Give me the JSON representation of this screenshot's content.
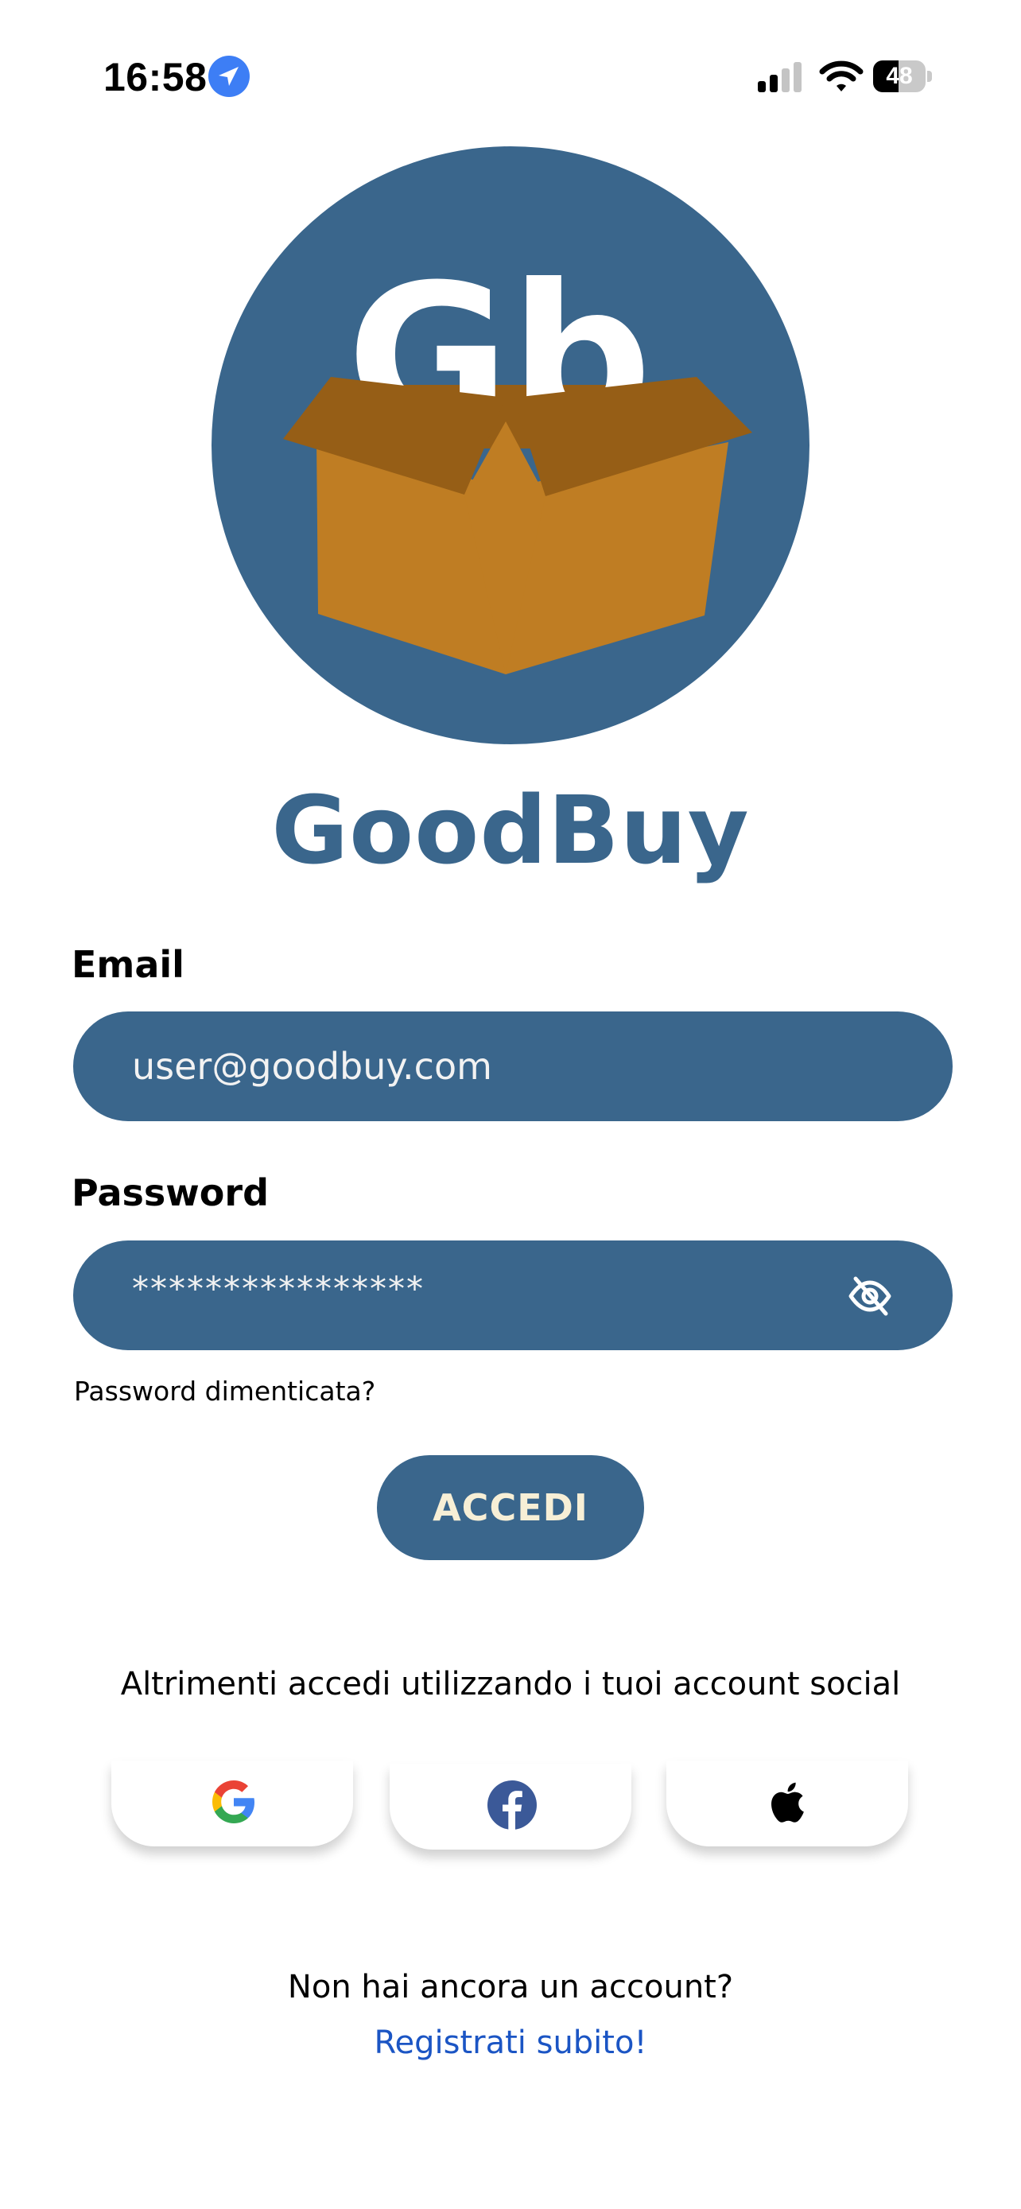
{
  "status_bar": {
    "time": "16:58",
    "battery_percent": "48",
    "battery_level": 0.48,
    "icons": [
      "location-arrow-icon",
      "cellular-signal-icon",
      "wifi-icon",
      "battery-icon"
    ]
  },
  "logo": {
    "monogram": "Gb",
    "colors": {
      "circle": "#3a668c",
      "box_front": "#bf7d23",
      "box_flaps": "#965e16",
      "letters": "#ffffff"
    }
  },
  "app_name": "GoodBuy",
  "form": {
    "email": {
      "label": "Email",
      "value": "user@goodbuy.com"
    },
    "password": {
      "label": "Password",
      "value": "****************",
      "toggle_icon": "eye-off-icon"
    },
    "forgot_password": "Password dimenticata?",
    "submit_label": "ACCEDI"
  },
  "social": {
    "caption": "Altrimenti accedi utilizzando i tuoi account social",
    "providers": [
      {
        "name": "Google",
        "icon": "google-icon"
      },
      {
        "name": "Facebook",
        "icon": "facebook-icon"
      },
      {
        "name": "Apple",
        "icon": "apple-icon"
      }
    ]
  },
  "signup": {
    "prompt": "Non hai ancora un account?",
    "link": "Registrati subito!"
  },
  "colors": {
    "primary": "#3a668c",
    "button_text": "#f7efd6",
    "link": "#1b55c4",
    "location_icon": "#3d7ef5"
  }
}
